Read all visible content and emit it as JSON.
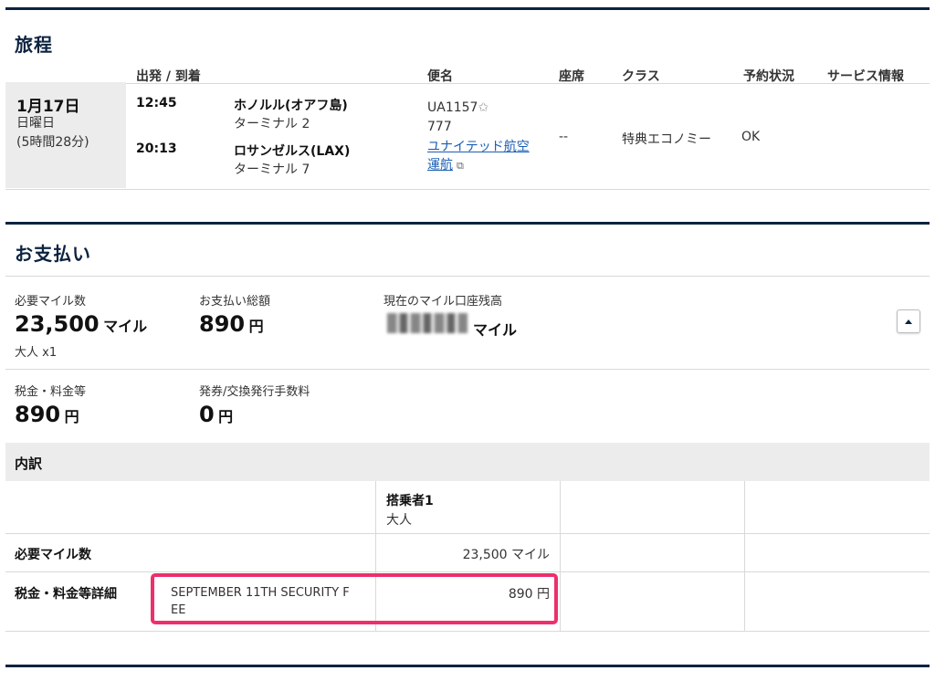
{
  "itinerary": {
    "title": "旅程",
    "headers": {
      "depart_arrive": "出発 / 到着",
      "flight": "便名",
      "seat": "座席",
      "class": "クラス",
      "status": "予約状況",
      "service": "サービス情報"
    },
    "segment": {
      "date": "1月17日",
      "weekday": "日曜日",
      "duration": "(5時間28分)",
      "depart_time": "12:45",
      "depart_city": "ホノルル(オアフ島)",
      "depart_terminal": "ターミナル 2",
      "arrive_time": "20:13",
      "arrive_city": "ロサンゼルス(LAX)",
      "arrive_terminal": "ターミナル 7",
      "flight_number": "UA1157",
      "aircraft": "777",
      "operator_line1": "ユナイテッド航空",
      "operator_line2": "運航",
      "seat": "--",
      "class": "特典エコノミー",
      "status": "OK"
    }
  },
  "payment": {
    "title": "お支払い",
    "required_miles_label": "必要マイル数",
    "required_miles_value": "23,500",
    "required_miles_unit": "マイル",
    "passengers": "大人 x1",
    "total_label": "お支払い総額",
    "total_value": "890",
    "total_unit": "円",
    "balance_label": "現在のマイル口座残高",
    "balance_unit": "マイル",
    "taxes_label": "税金・料金等",
    "taxes_value": "890",
    "taxes_unit": "円",
    "fee_label": "発券/交換発行手数料",
    "fee_value": "0",
    "fee_unit": "円"
  },
  "breakdown": {
    "title": "内訳",
    "passenger_header": "搭乗者1",
    "passenger_type": "大人",
    "miles_row_label": "必要マイル数",
    "miles_row_value": "23,500 マイル",
    "tax_row_label": "税金・料金等詳細",
    "tax_item_line1": "SEPTEMBER 11TH SECURITY F",
    "tax_item_line2": "EE",
    "tax_item_value": "890 円"
  },
  "colors": {
    "navy": "#0c2340",
    "link": "#1a5fb4",
    "highlight": "#ee2f6c"
  }
}
